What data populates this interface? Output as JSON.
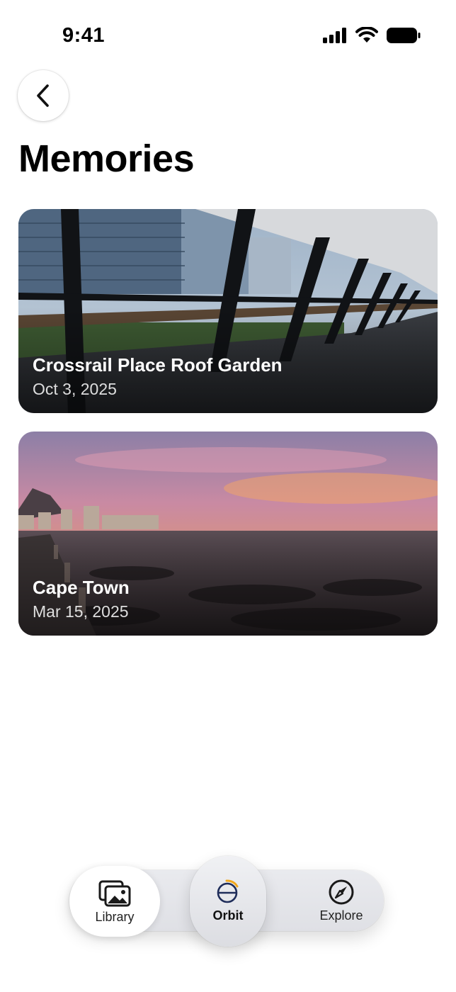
{
  "status_bar": {
    "time": "9:41"
  },
  "header": {
    "title": "Memories"
  },
  "memories": [
    {
      "title": "Crossrail Place Roof Garden",
      "date": "Oct 3, 2025"
    },
    {
      "title": "Cape Town",
      "date": "Mar 15, 2025"
    }
  ],
  "tabbar": {
    "tabs": [
      {
        "label": "Library",
        "icon": "photo-library-icon",
        "selected": true
      },
      {
        "label": "Orbit",
        "icon": "orbit-icon"
      },
      {
        "label": "Explore",
        "icon": "compass-icon"
      }
    ]
  },
  "colors": {
    "orbit_accent": "#f2a81d",
    "orbit_ring": "#1f2d5a"
  }
}
